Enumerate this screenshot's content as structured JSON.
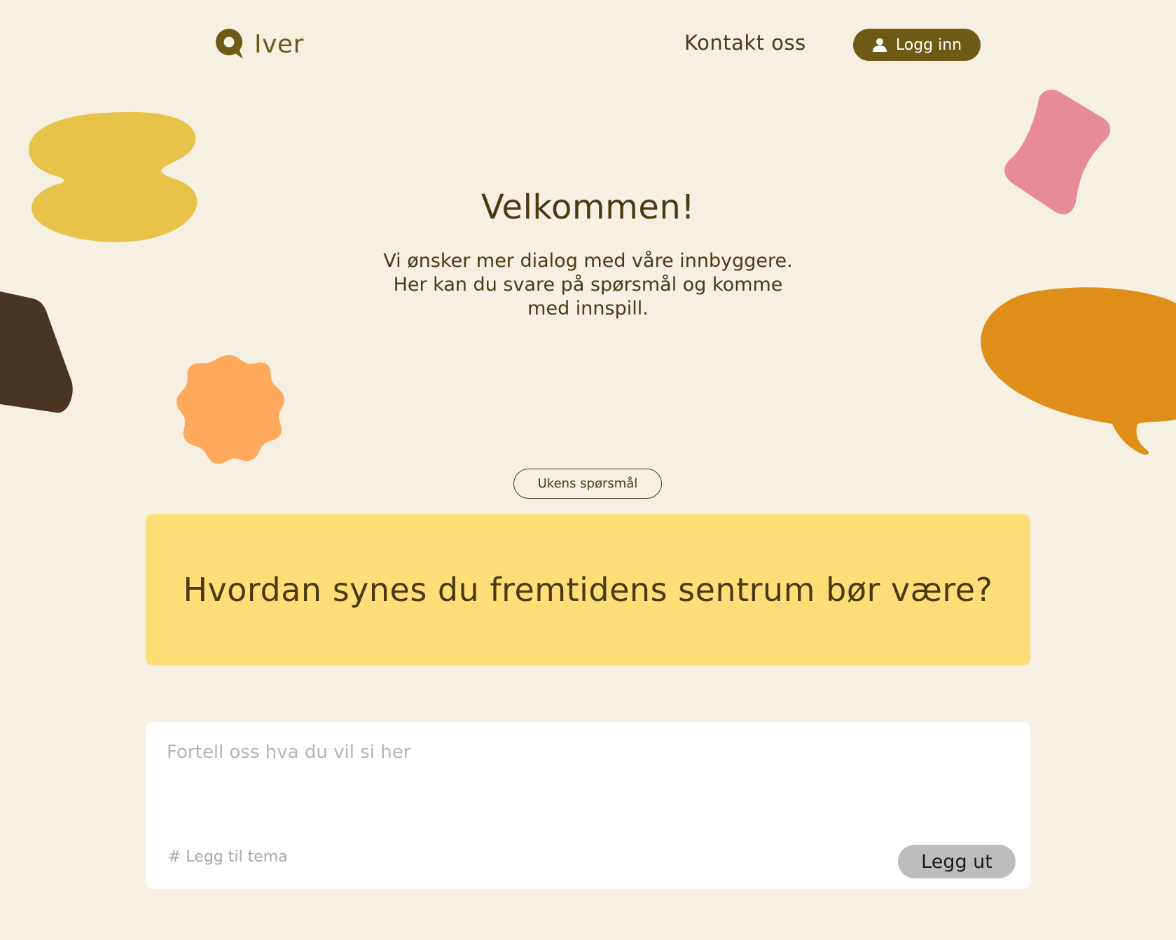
{
  "header": {
    "logo_text": "Iver",
    "contact_link": "Kontakt oss",
    "login_button": "Logg inn"
  },
  "hero": {
    "title": "Velkommen!",
    "text_line1": "Vi ønsker mer dialog med våre innbyggere.",
    "text_line2": "Her kan du svare på spørsmål og komme",
    "text_line3": "med innspill."
  },
  "weekly": {
    "label": "Ukens spørsmål",
    "question": "Hvordan synes du fremtidens sentrum bør være?"
  },
  "answer": {
    "placeholder": "Fortell oss hva du vil si her",
    "tag_link": "# Legg til tema",
    "submit_button": "Legg ut"
  },
  "colors": {
    "background": "#f5f0e2",
    "text": "#4a3a10",
    "brand": "#6f5a15",
    "question_card": "#ffde78",
    "yellow_blob": "#e8c34a",
    "pink_blob": "#e78c94",
    "dark_blob": "#4a3620",
    "orange_flower": "#ffa95c",
    "orange_bubble": "#e08e1a",
    "submit_disabled": "#bdbdbd"
  }
}
